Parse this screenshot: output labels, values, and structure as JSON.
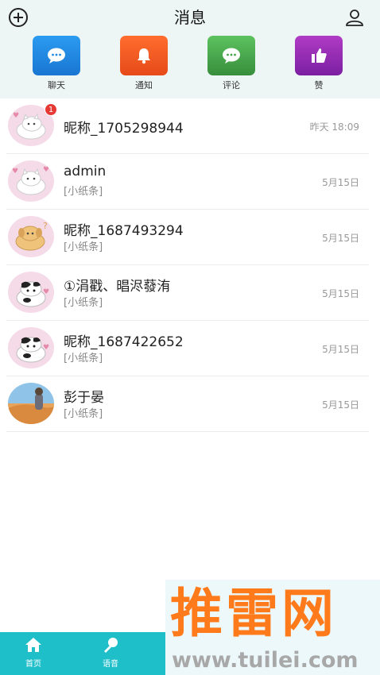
{
  "header": {
    "title": "消息",
    "categories": [
      {
        "label": "聊天",
        "color": "#1e88e5",
        "icon": "chat-bubble-icon"
      },
      {
        "label": "通知",
        "color": "#f4511e",
        "icon": "bell-icon"
      },
      {
        "label": "评论",
        "color": "#43a047",
        "icon": "comment-icon"
      },
      {
        "label": "赞",
        "color": "#9c27b0",
        "icon": "thumbs-up-icon"
      }
    ]
  },
  "conversations": [
    {
      "name": "昵称_1705298944",
      "sub": "",
      "time": "昨天 18:09",
      "badge": "1",
      "avatar": "cat-sticker"
    },
    {
      "name": "admin",
      "sub": "[小纸条]",
      "time": "5月15日",
      "badge": "",
      "avatar": "cat-sticker"
    },
    {
      "name": "昵称_1687493294",
      "sub": "[小纸条]",
      "time": "5月15日",
      "badge": "",
      "avatar": "dog-sticker"
    },
    {
      "name": "①涓戳、晿浕蕟洧",
      "sub": "[小纸条]",
      "time": "5月15日",
      "badge": "",
      "avatar": "cow-cat-sticker"
    },
    {
      "name": "昵称_1687422652",
      "sub": "[小纸条]",
      "time": "5月15日",
      "badge": "",
      "avatar": "cow-cat-sticker"
    },
    {
      "name": "彭于晏",
      "sub": "[小纸条]",
      "time": "5月15日",
      "badge": "",
      "avatar": "desert-photo"
    }
  ],
  "tabbar": {
    "home": "首页",
    "voice": "语音"
  },
  "watermark": {
    "brand": "推雷网",
    "url": "www.tuilei.com"
  }
}
